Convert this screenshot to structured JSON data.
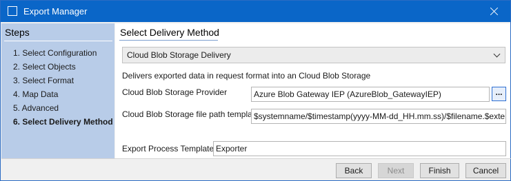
{
  "window": {
    "title": "Export Manager"
  },
  "sidebar": {
    "title": "Steps",
    "steps": [
      "1. Select Configuration",
      "2. Select Objects",
      "3. Select Format",
      "4. Map Data",
      "5. Advanced",
      "6. Select Delivery Method"
    ],
    "active_step": 6
  },
  "main": {
    "title": "Select Delivery Method",
    "delivery_method": "Cloud Blob Storage Delivery",
    "description": "Delivers exported data in request format into an Cloud Blob Storage",
    "provider_label": "Cloud Blob Storage Provider",
    "provider_value": "Azure Blob Gateway IEP (AzureBlob_GatewayIEP)",
    "browse_label": "...",
    "path_template_label": "Cloud Blob Storage file path template",
    "path_template_value": "$systemname/$timestamp(yyyy-MM-dd_HH.mm.ss)/$filename.$extension",
    "process_template_label": "Export Process Template:",
    "process_template_value": "Exporter"
  },
  "footer": {
    "back": "Back",
    "next": "Next",
    "finish": "Finish",
    "cancel": "Cancel"
  },
  "colors": {
    "titlebar": "#0a66c8",
    "sidebar": "#b8cce8",
    "focus_border": "#2d6fd2"
  },
  "icons": {
    "app": "window-icon",
    "close": "close-icon",
    "dropdown": "chevron-down-icon"
  }
}
